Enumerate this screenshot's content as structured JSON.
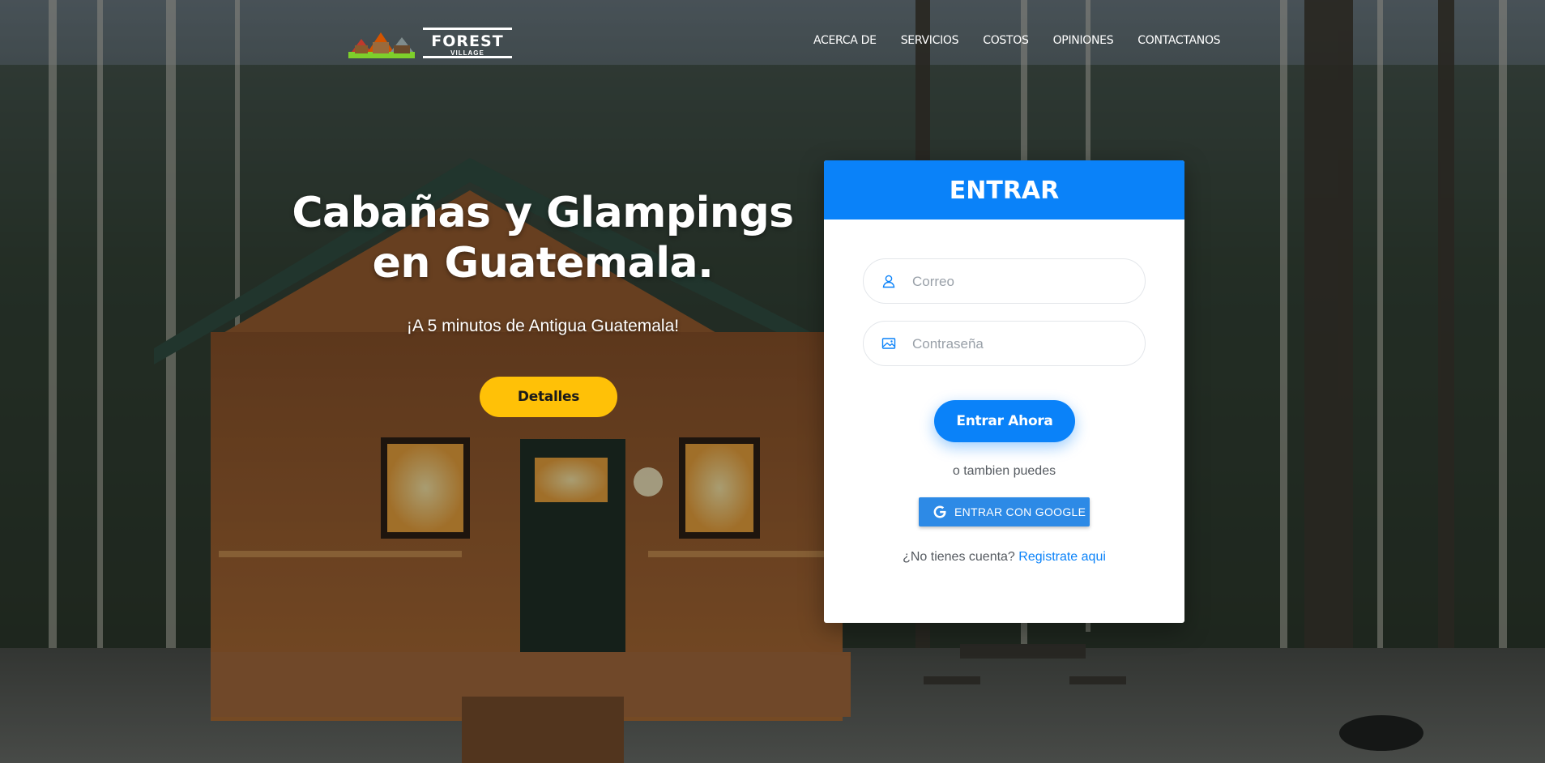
{
  "nav": {
    "logo": {
      "word1": "FOREST",
      "word2": "VILLAGE"
    },
    "links": [
      {
        "label": "ACERCA DE"
      },
      {
        "label": "SERVICIOS"
      },
      {
        "label": "COSTOS"
      },
      {
        "label": "OPINIONES"
      },
      {
        "label": "CONTACTANOS"
      }
    ]
  },
  "hero": {
    "title": "Cabañas y Glampings en Guatemala.",
    "subtitle": "¡A 5 minutos de Antigua Guatemala!",
    "button_label": "Detalles"
  },
  "login": {
    "header": "ENTRAR",
    "email_placeholder": "Correo",
    "password_placeholder": "Contraseña",
    "submit_label": "Entrar Ahora",
    "or_text": "o tambien puedes",
    "google_label": "ENTRAR CON GOOGLE",
    "signup_prompt": "¿No tienes cuenta?",
    "signup_link": "Registrate aqui"
  },
  "colors": {
    "primary": "#0a82f9",
    "accent": "#ffc107",
    "google_button": "#2d8ae6"
  },
  "icons": {
    "email_field": "user-icon",
    "password_field": "image-icon",
    "google": "google-g-icon"
  }
}
